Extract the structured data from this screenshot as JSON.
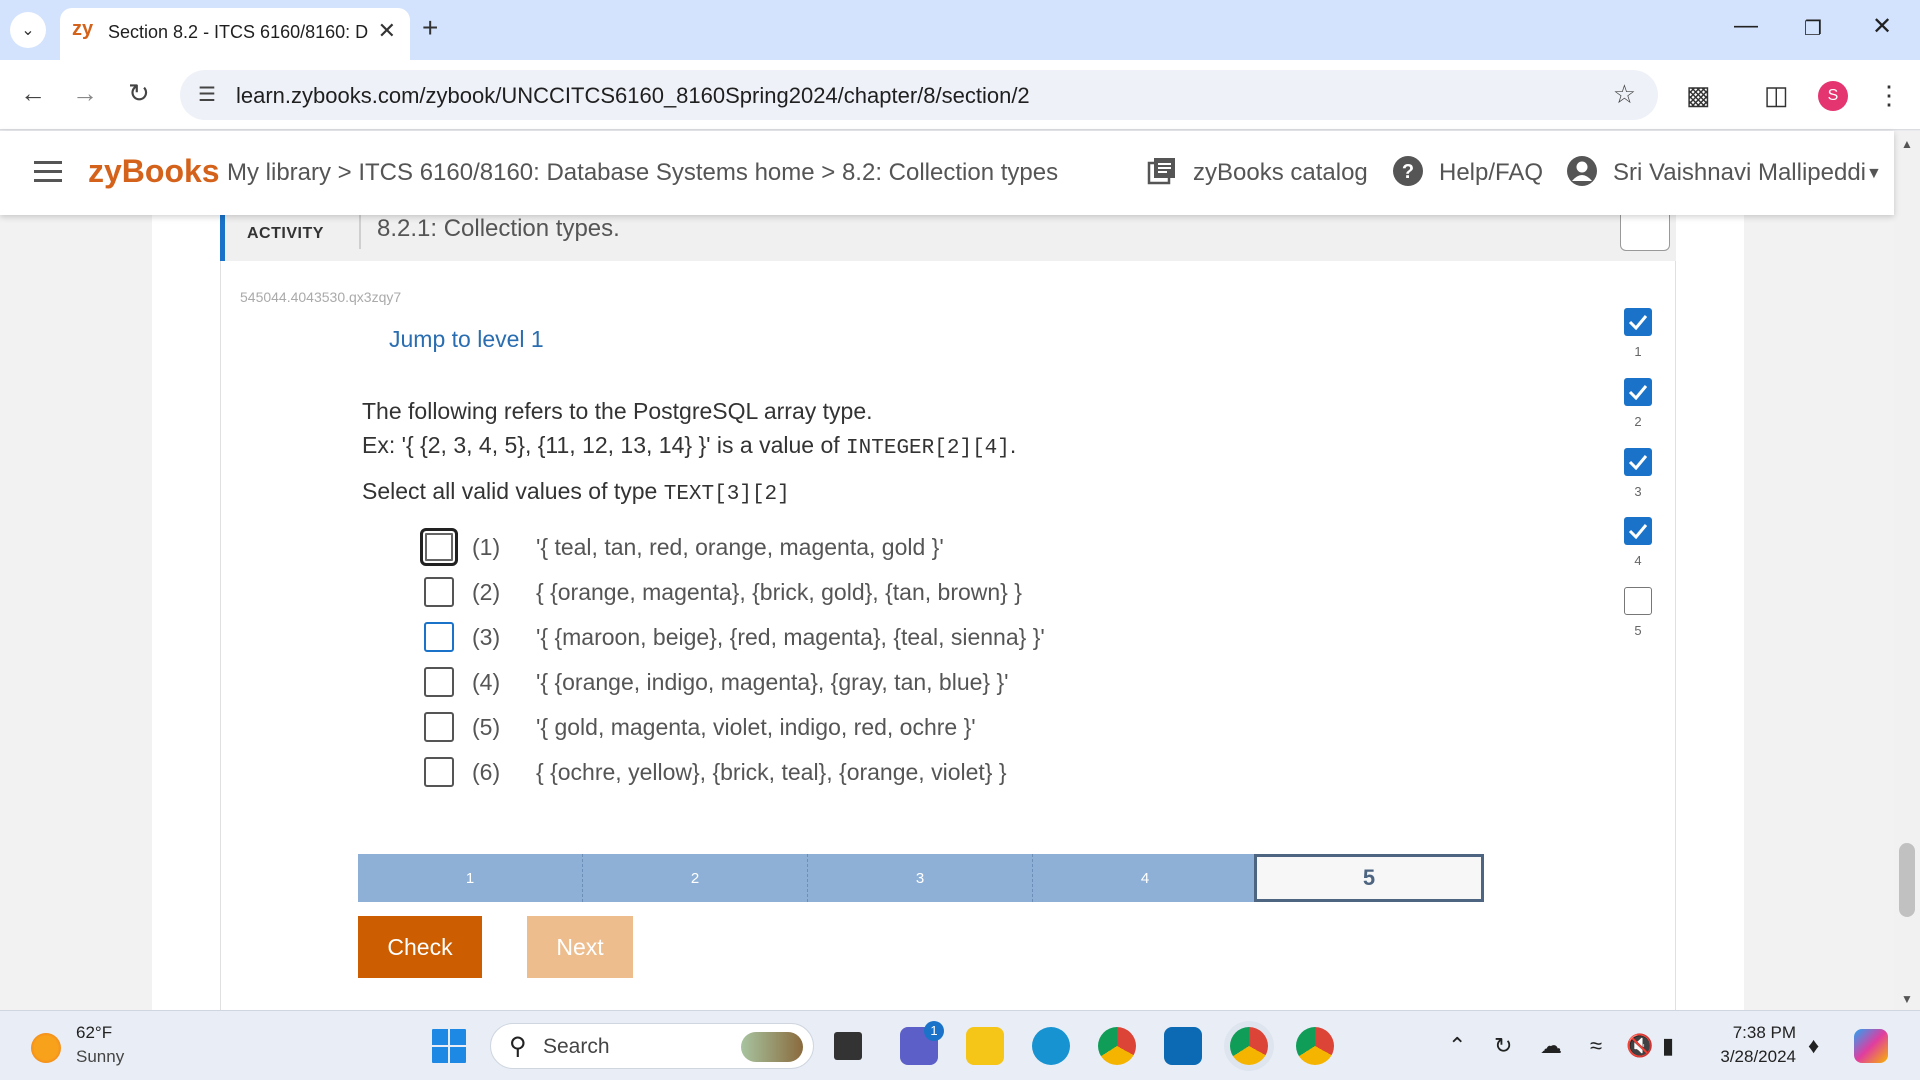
{
  "browser": {
    "tab_icon": "zy",
    "tab_title": "Section 8.2 - ITCS 6160/8160: D",
    "url": "learn.zybooks.com/zybook/UNCCITCS6160_8160Spring2024/chapter/8/section/2",
    "profile_initial": "S"
  },
  "header": {
    "logo": "zyBooks",
    "breadcrumb": "My library > ITCS 6160/8160: Database Systems home > 8.2: Collection types",
    "catalog_label": "zyBooks catalog",
    "help_label": "Help/FAQ",
    "user_name": "Sri Vaishnavi Mallipeddi"
  },
  "activity": {
    "type_label": "ACTIVITY",
    "title": "8.2.1: Collection types.",
    "id": "545044.4043530.qx3zqy7",
    "jump_label": "Jump to level 1",
    "intro_line1": "The following refers to the PostgreSQL array type.",
    "intro_line2_prefix": "Ex: '{ {2, 3, 4, 5}, {11, 12, 13, 14} }' is a value of ",
    "intro_line2_code": "INTEGER[2][4]",
    "intro_line2_suffix": ".",
    "prompt_prefix": "Select all valid values of type ",
    "prompt_code": "TEXT[3][2]",
    "options": [
      {
        "num": "(1)",
        "value": "'{ teal, tan, red, orange, magenta, gold }'"
      },
      {
        "num": "(2)",
        "value": "{ {orange, magenta}, {brick, gold}, {tan, brown} }"
      },
      {
        "num": "(3)",
        "value": "'{ {maroon, beige}, {red, magenta}, {teal, sienna} }'"
      },
      {
        "num": "(4)",
        "value": "'{ {orange, indigo, magenta}, {gray, tan, blue} }'"
      },
      {
        "num": "(5)",
        "value": "'{ gold, magenta, violet, indigo, red, ochre }'"
      },
      {
        "num": "(6)",
        "value": "{ {ochre, yellow}, {brick, teal}, {orange, violet} }"
      }
    ],
    "levels": [
      {
        "num": "1",
        "done": true
      },
      {
        "num": "2",
        "done": true
      },
      {
        "num": "3",
        "done": true
      },
      {
        "num": "4",
        "done": true
      },
      {
        "num": "5",
        "done": false
      }
    ],
    "progress": [
      "1",
      "2",
      "3",
      "4",
      "5"
    ],
    "current_level": "5",
    "check_label": "Check",
    "next_label": "Next"
  },
  "taskbar": {
    "temp": "62°F",
    "condition": "Sunny",
    "search_placeholder": "Search",
    "teams_badge": "1",
    "time": "7:38 PM",
    "date": "3/28/2024"
  },
  "colors": {
    "accent": "#d4621a",
    "link": "#2a6db0",
    "level_done": "#1a73c8",
    "progress_done": "#8fb0d6",
    "check_button": "#cc5d00",
    "next_button": "#edbd8e"
  }
}
